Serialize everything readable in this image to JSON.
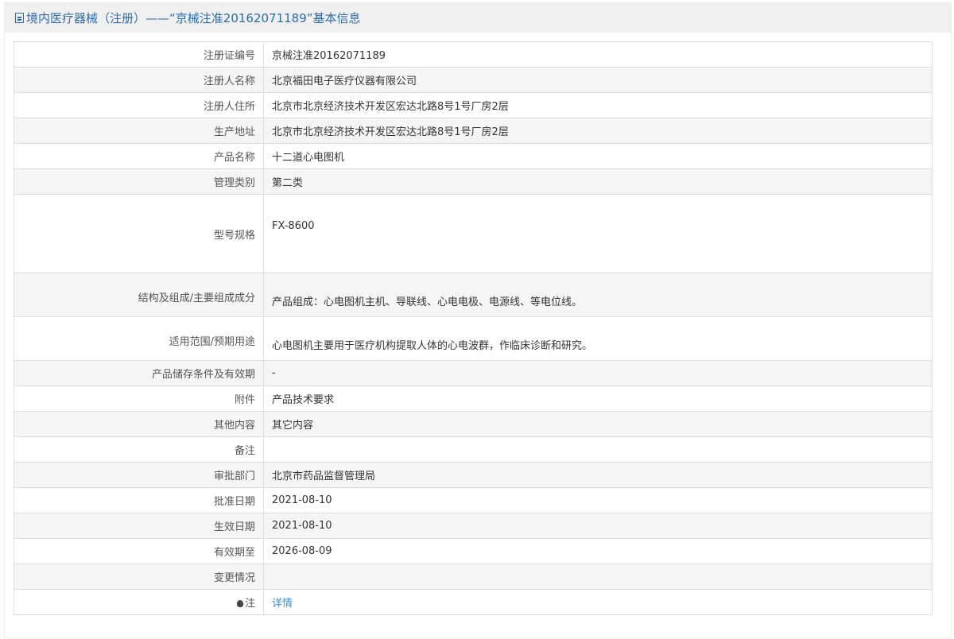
{
  "header": {
    "title": "境内医疗器械（注册）——“京械注准20162071189”基本信息"
  },
  "rows": [
    {
      "label": "注册证编号",
      "value": "京械注准20162071189"
    },
    {
      "label": "注册人名称",
      "value": "北京福田电子医疗仪器有限公司"
    },
    {
      "label": "注册人住所",
      "value": "北京市北京经济技术开发区宏达北路8号1号厂房2层"
    },
    {
      "label": "生产地址",
      "value": "北京市北京经济技术开发区宏达北路8号1号厂房2层"
    },
    {
      "label": "产品名称",
      "value": "十二道心电图机"
    },
    {
      "label": "管理类别",
      "value": "第二类"
    },
    {
      "label": "型号规格",
      "value": "FX-8600"
    },
    {
      "label": "结构及组成/主要组成成分",
      "value": "产品组成：心电图机主机、导联线、心电电极、电源线、等电位线。"
    },
    {
      "label": "适用范围/预期用途",
      "value": "心电图机主要用于医疗机构提取人体的心电波群，作临床诊断和研究。"
    },
    {
      "label": "产品储存条件及有效期",
      "value": "-"
    },
    {
      "label": "附件",
      "value": "产品技术要求"
    },
    {
      "label": "其他内容",
      "value": "其它内容"
    },
    {
      "label": "备注",
      "value": ""
    },
    {
      "label": "审批部门",
      "value": "北京市药品监督管理局"
    },
    {
      "label": "批准日期",
      "value": "2021-08-10"
    },
    {
      "label": "生效日期",
      "value": "2021-08-10"
    },
    {
      "label": "有效期至",
      "value": "2026-08-09"
    },
    {
      "label": "变更情况",
      "value": ""
    },
    {
      "label": "注",
      "value": "详情"
    }
  ]
}
